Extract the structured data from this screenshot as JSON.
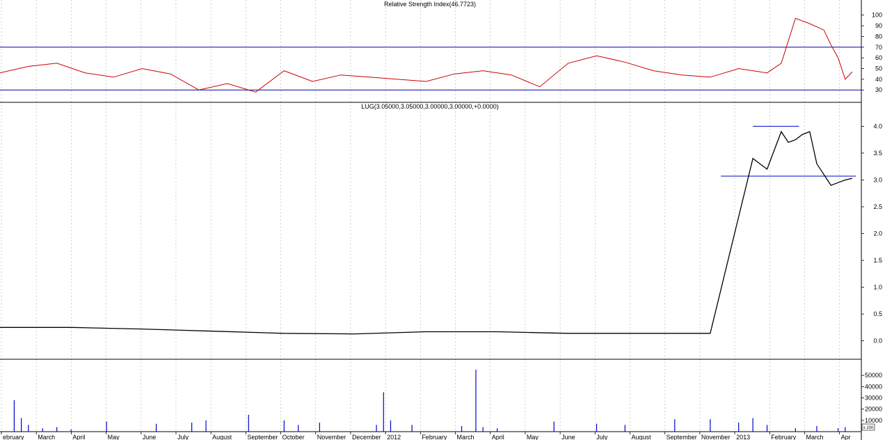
{
  "chart_data": [
    {
      "type": "line",
      "title": "Relative Strength Index(46.7723)",
      "ylim": [
        23,
        105
      ],
      "yticks": [
        "100",
        "90",
        "80",
        "70",
        "60",
        "50",
        "40",
        "30"
      ],
      "reference_lines": [
        70,
        30
      ],
      "series": [
        {
          "color": "#cc0000",
          "x": [
            0,
            4,
            8,
            12,
            16,
            20,
            24,
            28,
            32,
            36,
            40,
            44,
            48,
            52,
            56,
            60,
            64,
            68,
            72,
            76,
            80,
            84,
            88,
            92,
            96,
            100,
            104,
            108,
            110,
            112,
            114,
            116,
            117,
            118,
            119,
            120
          ],
          "values": [
            46,
            52,
            55,
            46,
            42,
            50,
            45,
            30,
            36,
            28,
            48,
            38,
            44,
            42,
            40,
            38,
            45,
            48,
            44,
            33,
            55,
            62,
            56,
            48,
            44,
            42,
            50,
            46,
            55,
            97,
            92,
            86,
            72,
            60,
            40,
            47
          ]
        }
      ]
    },
    {
      "type": "line",
      "title": "LUG(3.05000,3.05000,3.00000,3.00000,+0.0000)",
      "ylim": [
        -0.2,
        4.2
      ],
      "yticks": [
        "4.0",
        "3.5",
        "3.0",
        "2.5",
        "2.0",
        "1.5",
        "1.0",
        "0.5",
        "0.0"
      ],
      "series": [
        {
          "color": "#000000",
          "x": [
            0,
            10,
            20,
            30,
            40,
            50,
            60,
            70,
            80,
            90,
            100,
            106,
            108,
            110,
            111,
            112,
            113,
            114,
            115,
            116,
            117,
            118,
            119,
            120
          ],
          "values": [
            0.25,
            0.25,
            0.22,
            0.18,
            0.14,
            0.13,
            0.17,
            0.17,
            0.14,
            0.14,
            0.14,
            3.4,
            3.2,
            3.9,
            3.7,
            3.75,
            3.85,
            3.9,
            3.3,
            3.1,
            2.9,
            2.95,
            3.0,
            3.03
          ]
        }
      ],
      "levels": [
        4.0,
        3.07
      ]
    },
    {
      "type": "bar",
      "title": "",
      "ylim": [
        0,
        60000
      ],
      "yticks": [
        "50000",
        "40000",
        "30000",
        "20000",
        "10000"
      ],
      "scale_label": "x 100",
      "series": [
        {
          "color": "#0000cc",
          "x": [
            2,
            3,
            4,
            6,
            8,
            10,
            15,
            22,
            27,
            29,
            35,
            40,
            42,
            45,
            53,
            54,
            55,
            58,
            65,
            67,
            68,
            70,
            78,
            84,
            88,
            95,
            100,
            104,
            106,
            108,
            112,
            115,
            118,
            119
          ],
          "values": [
            28000,
            12000,
            6000,
            3000,
            4000,
            2000,
            9000,
            7000,
            8000,
            10000,
            15000,
            10000,
            6000,
            8000,
            6000,
            35000,
            10000,
            6000,
            5000,
            55000,
            4000,
            3000,
            9000,
            7000,
            6000,
            11000,
            11000,
            8000,
            12000,
            6000,
            3000,
            5000,
            3000,
            4000
          ]
        }
      ]
    }
  ],
  "x_axis": {
    "labels": [
      "ebruary",
      "March",
      "April",
      "May",
      "June",
      "July",
      "August",
      "September",
      "October",
      "November",
      "December",
      "2012",
      "February",
      "March",
      "April",
      "May",
      "June",
      "July",
      "August",
      "September",
      "November",
      "2013",
      "February",
      "March",
      "Apr"
    ]
  }
}
